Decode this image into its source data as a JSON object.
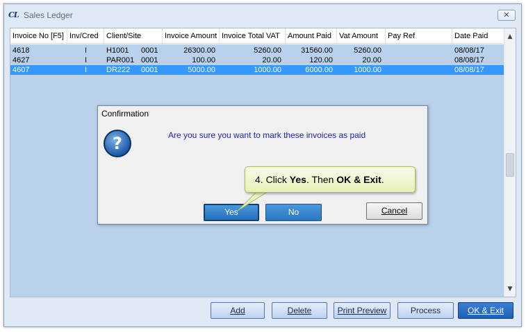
{
  "window": {
    "logo_text": "CL",
    "title": "Sales Ledger",
    "close_glyph": "✕"
  },
  "grid": {
    "columns": [
      "Invoice No [F5]",
      "Inv/Cred",
      "Client/Site",
      "Invoice Amount",
      "Invoice Total VAT",
      "Amount Paid",
      "Vat Amount",
      "Pay Ref",
      "Date Paid"
    ],
    "rows": [
      {
        "invoice_no": "4618",
        "inv_cred": "I",
        "client": "H1001",
        "site": "0001",
        "invoice_amount": "26300.00",
        "invoice_total_vat": "5260.00",
        "amount_paid": "31560.00",
        "vat_amount": "5260.00",
        "pay_ref": "",
        "date_paid": "08/08/17",
        "selected": false
      },
      {
        "invoice_no": "4627",
        "inv_cred": "I",
        "client": "PAR001",
        "site": "0001",
        "invoice_amount": "100.00",
        "invoice_total_vat": "20.00",
        "amount_paid": "120.00",
        "vat_amount": "20.00",
        "pay_ref": "",
        "date_paid": "08/08/17",
        "selected": false
      },
      {
        "invoice_no": "4607",
        "inv_cred": "I",
        "client": "DR222",
        "site": "0001",
        "invoice_amount": "5000.00",
        "invoice_total_vat": "1000.00",
        "amount_paid": "6000.00",
        "vat_amount": "1000.00",
        "pay_ref": "",
        "date_paid": "08/08/17",
        "selected": true
      }
    ],
    "scroll_up_glyph": "▲",
    "scroll_down_glyph": "▼"
  },
  "toolbar": {
    "add": "Add",
    "delete": "Delete",
    "print_preview": "Print Preview",
    "process": "Process",
    "ok_exit": "OK & Exit"
  },
  "dialog": {
    "title": "Confirmation",
    "icon": "question-icon",
    "icon_glyph": "?",
    "message": "Are you sure you want to mark these invoices as paid",
    "yes": "Yes",
    "no": "No",
    "cancel": "Cancel"
  },
  "callout": {
    "prefix": "4. Click ",
    "bold1": "Yes",
    "middle": ". Then ",
    "bold2": "OK & Exit",
    "suffix": "."
  },
  "colors": {
    "selected_row": "#3399ff",
    "grid_background": "#b9d1ea",
    "dialog_message": "#2222aa",
    "callout_fill": "#e6f1b8"
  }
}
